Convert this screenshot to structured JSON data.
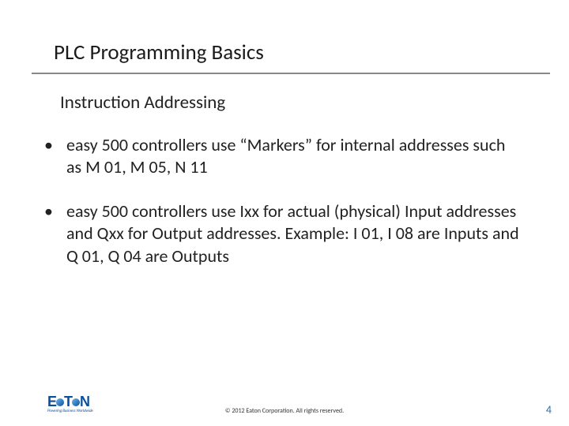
{
  "title": "PLC Programming Basics",
  "subtitle": "Instruction Addressing",
  "bullets": [
    "easy 500 controllers use “Markers” for internal addresses such as M 01, M 05, N 11",
    "easy 500 controllers use Ixx for actual (physical) Input addresses and Qxx for Output addresses. Example: I 01, I 08 are Inputs and Q 01, Q 04 are Outputs"
  ],
  "logo": {
    "left": "E",
    "mid": "T",
    "right": "N",
    "tagline": "Powering Business Worldwide"
  },
  "footer": {
    "copyright": "© 2012 Eaton Corporation. All rights reserved.",
    "page": "4"
  }
}
